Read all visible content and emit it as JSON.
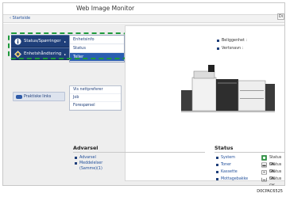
{
  "app": {
    "title": "Web Image Monitor"
  },
  "navbar": {
    "back_link": "‹ Startside",
    "right_button": "Di"
  },
  "left_menu": {
    "items": [
      {
        "label": "Status/Spørringer",
        "icon": "info-icon",
        "arrow": "▸"
      },
      {
        "label": "Enhetshåndtering",
        "icon": "device-management-icon",
        "arrow": "▸"
      }
    ],
    "practical_links": {
      "label": "Praktiske links",
      "icon": "links-icon"
    }
  },
  "submenu_primary": {
    "items": [
      {
        "label": "Enhetsinfo",
        "selected": false
      },
      {
        "label": "Status",
        "selected": false
      },
      {
        "label": "Teller",
        "selected": true
      }
    ]
  },
  "submenu_secondary": {
    "items": [
      {
        "label": "Vis nettpreferer"
      },
      {
        "label": "Job"
      },
      {
        "label": "Forespørsel"
      }
    ]
  },
  "device_info": {
    "rows": [
      {
        "label": "Beliggenhet :"
      },
      {
        "label": "Vertsnavn :"
      }
    ]
  },
  "warning": {
    "heading": "Advarsel",
    "items": [
      "Advarsel",
      "Meddelelser",
      "(Samme)(1)"
    ]
  },
  "status": {
    "heading": "Status",
    "rows": [
      {
        "name": "System",
        "icon": "system-status-icon",
        "value": "Status OK"
      },
      {
        "name": "Toner",
        "icon": "toner-status-icon",
        "value": "Status OK"
      },
      {
        "name": "Kassette",
        "icon": "tray-status-icon",
        "value": "Status OK"
      },
      {
        "name": "Mottagebakke",
        "icon": "output-tray-status-icon",
        "value": "Status OK"
      }
    ]
  },
  "figure_code": "D0CPAC6525",
  "colors": {
    "menu_blue": "#1f3f7a",
    "selected_blue": "#2a5eb0",
    "highlight_green": "#1e9a3c"
  }
}
